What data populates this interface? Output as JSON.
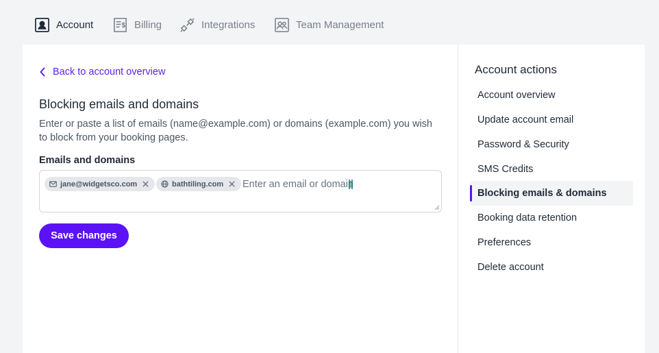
{
  "tabs": [
    {
      "label": "Account",
      "icon": "account-icon",
      "active": true
    },
    {
      "label": "Billing",
      "icon": "billing-icon",
      "active": false
    },
    {
      "label": "Integrations",
      "icon": "integrations-icon",
      "active": false
    },
    {
      "label": "Team Management",
      "icon": "team-icon",
      "active": false
    }
  ],
  "main": {
    "back_label": "Back to account overview",
    "title": "Blocking emails and domains",
    "description": "Enter or paste a list of emails (name@example.com) or domains (example.com) you wish to block from your booking pages.",
    "field_label": "Emails and domains",
    "chips": [
      {
        "label": "jane@widgetsco.com",
        "icon": "mail-icon"
      },
      {
        "label": "bathtiling.com",
        "icon": "globe-icon"
      }
    ],
    "input_placeholder": "Enter an email or domain",
    "save_label": "Save changes"
  },
  "side": {
    "title": "Account actions",
    "items": [
      {
        "label": "Account overview",
        "active": false
      },
      {
        "label": "Update account email",
        "active": false
      },
      {
        "label": "Password & Security",
        "active": false
      },
      {
        "label": "SMS Credits",
        "active": false
      },
      {
        "label": "Blocking emails & domains",
        "active": true
      },
      {
        "label": "Booking data retention",
        "active": false
      },
      {
        "label": "Preferences",
        "active": false
      },
      {
        "label": "Delete account",
        "active": false
      }
    ]
  },
  "colors": {
    "accent": "#5b12f5",
    "link": "#5b21f0"
  }
}
